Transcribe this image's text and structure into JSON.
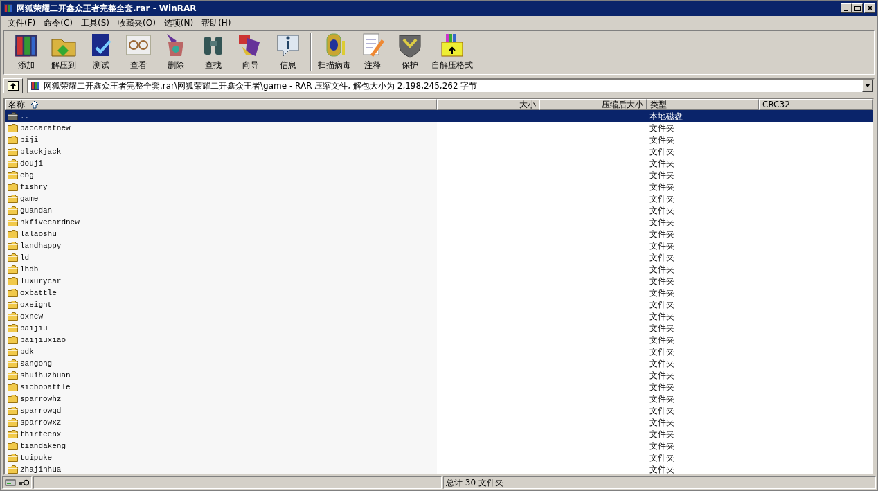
{
  "window": {
    "title": "网狐荣耀二开鑫众王者完整全套.rar - WinRAR"
  },
  "menu": [
    "文件(F)",
    "命令(C)",
    "工具(S)",
    "收藏夹(O)",
    "选项(N)",
    "帮助(H)"
  ],
  "toolbar": [
    {
      "label": "添加"
    },
    {
      "label": "解压到"
    },
    {
      "label": "测试"
    },
    {
      "label": "查看"
    },
    {
      "label": "删除"
    },
    {
      "label": "查找"
    },
    {
      "label": "向导"
    },
    {
      "label": "信息"
    },
    {
      "label": "扫描病毒",
      "separator_before": true
    },
    {
      "label": "注释"
    },
    {
      "label": "保护"
    },
    {
      "label": "自解压格式"
    }
  ],
  "address": "网狐荣耀二开鑫众王者完整全套.rar\\网狐荣耀二开鑫众王者\\game - RAR 压缩文件, 解包大小为 2,198,245,262 字节",
  "table": {
    "columns": [
      {
        "label": "名称",
        "sorted": true
      },
      {
        "label": "大小"
      },
      {
        "label": "压缩后大小"
      },
      {
        "label": "类型"
      },
      {
        "label": "CRC32"
      }
    ],
    "rows": [
      {
        "name": "..",
        "type": "本地磁盘",
        "kind": "parent",
        "selected": true
      },
      {
        "name": "baccaratnew",
        "type": "文件夹",
        "kind": "folder",
        "selected": false
      },
      {
        "name": "biji",
        "type": "文件夹",
        "kind": "folder",
        "selected": false
      },
      {
        "name": "blackjack",
        "type": "文件夹",
        "kind": "folder",
        "selected": false
      },
      {
        "name": "douji",
        "type": "文件夹",
        "kind": "folder",
        "selected": false
      },
      {
        "name": "ebg",
        "type": "文件夹",
        "kind": "folder",
        "selected": false
      },
      {
        "name": "fishry",
        "type": "文件夹",
        "kind": "folder",
        "selected": false
      },
      {
        "name": "game",
        "type": "文件夹",
        "kind": "folder",
        "selected": false
      },
      {
        "name": "guandan",
        "type": "文件夹",
        "kind": "folder",
        "selected": false
      },
      {
        "name": "hkfivecardnew",
        "type": "文件夹",
        "kind": "folder",
        "selected": false
      },
      {
        "name": "lalaoshu",
        "type": "文件夹",
        "kind": "folder",
        "selected": false
      },
      {
        "name": "landhappy",
        "type": "文件夹",
        "kind": "folder",
        "selected": false
      },
      {
        "name": "ld",
        "type": "文件夹",
        "kind": "folder",
        "selected": false
      },
      {
        "name": "lhdb",
        "type": "文件夹",
        "kind": "folder",
        "selected": false
      },
      {
        "name": "luxurycar",
        "type": "文件夹",
        "kind": "folder",
        "selected": false
      },
      {
        "name": "oxbattle",
        "type": "文件夹",
        "kind": "folder",
        "selected": false
      },
      {
        "name": "oxeight",
        "type": "文件夹",
        "kind": "folder",
        "selected": false
      },
      {
        "name": "oxnew",
        "type": "文件夹",
        "kind": "folder",
        "selected": false
      },
      {
        "name": "paijiu",
        "type": "文件夹",
        "kind": "folder",
        "selected": false
      },
      {
        "name": "paijiuxiao",
        "type": "文件夹",
        "kind": "folder",
        "selected": false
      },
      {
        "name": "pdk",
        "type": "文件夹",
        "kind": "folder",
        "selected": false
      },
      {
        "name": "sangong",
        "type": "文件夹",
        "kind": "folder",
        "selected": false
      },
      {
        "name": "shuihuzhuan",
        "type": "文件夹",
        "kind": "folder",
        "selected": false
      },
      {
        "name": "sicbobattle",
        "type": "文件夹",
        "kind": "folder",
        "selected": false
      },
      {
        "name": "sparrowhz",
        "type": "文件夹",
        "kind": "folder",
        "selected": false
      },
      {
        "name": "sparrowqd",
        "type": "文件夹",
        "kind": "folder",
        "selected": false
      },
      {
        "name": "sparrowxz",
        "type": "文件夹",
        "kind": "folder",
        "selected": false
      },
      {
        "name": "thirteenx",
        "type": "文件夹",
        "kind": "folder",
        "selected": false
      },
      {
        "name": "tiandakeng",
        "type": "文件夹",
        "kind": "folder",
        "selected": false
      },
      {
        "name": "tuipuke",
        "type": "文件夹",
        "kind": "folder",
        "selected": false
      },
      {
        "name": "zhajinhua",
        "type": "文件夹",
        "kind": "folder",
        "selected": false
      }
    ]
  },
  "status_bar": {
    "summary": "总计 30 文件夹"
  }
}
